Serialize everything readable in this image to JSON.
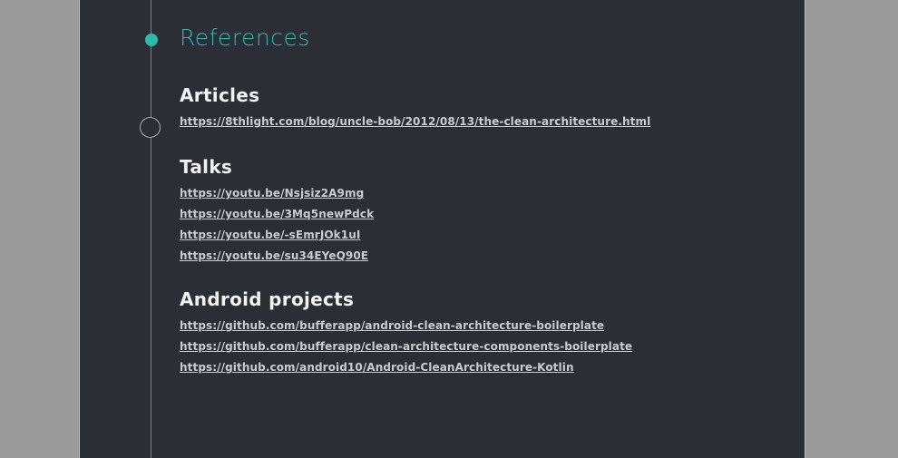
{
  "section": {
    "title": "References"
  },
  "groups": [
    {
      "heading": "Articles",
      "links": [
        "https://8thlight.com/blog/uncle-bob/2012/08/13/the-clean-architecture.html"
      ]
    },
    {
      "heading": "Talks",
      "links": [
        "https://youtu.be/Nsjsiz2A9mg",
        "https://youtu.be/3Mq5newPdck",
        "https://youtu.be/-sEmrJOk1uI",
        "https://youtu.be/su34EYeQ90E"
      ]
    },
    {
      "heading": "Android projects",
      "links": [
        "https://github.com/bufferapp/android-clean-architecture-boilerplate",
        "https://github.com/bufferapp/clean-architecture-components-boilerplate",
        "https://github.com/android10/Android-CleanArchitecture-Kotlin"
      ]
    }
  ],
  "colors": {
    "accent": "#2fb8ac",
    "background": "#2b2e35",
    "outer": "#9b9b9b"
  }
}
